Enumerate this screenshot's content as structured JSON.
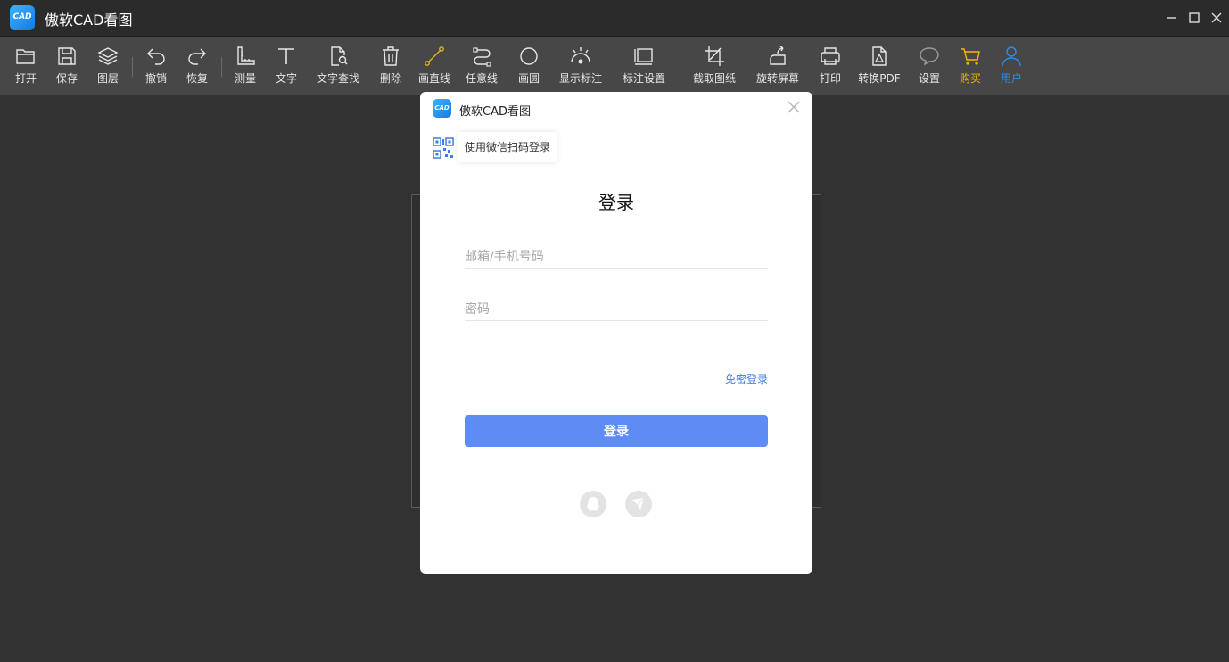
{
  "window": {
    "title": "傲软CAD看图",
    "logo_text": "CAD"
  },
  "toolbar": {
    "items": [
      {
        "label": "打开",
        "icon": "folder-icon"
      },
      {
        "label": "保存",
        "icon": "save-icon"
      },
      {
        "label": "图层",
        "icon": "layers-icon"
      },
      {
        "label": "撤销",
        "icon": "undo-icon"
      },
      {
        "label": "恢复",
        "icon": "redo-icon"
      },
      {
        "label": "测量",
        "icon": "ruler-icon"
      },
      {
        "label": "文字",
        "icon": "text-icon"
      },
      {
        "label": "文字查找",
        "icon": "text-search-icon"
      },
      {
        "label": "删除",
        "icon": "trash-icon"
      },
      {
        "label": "画直线",
        "icon": "line-icon"
      },
      {
        "label": "任意线",
        "icon": "polyline-icon"
      },
      {
        "label": "画圆",
        "icon": "circle-icon"
      },
      {
        "label": "显示标注",
        "icon": "show-annotation-icon"
      },
      {
        "label": "标注设置",
        "icon": "annotation-settings-icon"
      },
      {
        "label": "截取图纸",
        "icon": "crop-icon"
      },
      {
        "label": "旋转屏幕",
        "icon": "rotate-icon"
      },
      {
        "label": "打印",
        "icon": "printer-icon"
      },
      {
        "label": "转换PDF",
        "icon": "pdf-icon"
      },
      {
        "label": "设置",
        "icon": "chat-bubble-icon"
      },
      {
        "label": "购买",
        "icon": "cart-icon"
      },
      {
        "label": "用户",
        "icon": "user-icon"
      }
    ],
    "colors": {
      "buy": "#f5b800",
      "user": "#2f8bf0",
      "active_line": "#e6b422"
    }
  },
  "login_dialog": {
    "title": "傲软CAD看图",
    "logo_text": "CAD",
    "qr_tip": "使用微信扫码登录",
    "heading": "登录",
    "email_placeholder": "邮箱/手机号码",
    "email_value": "",
    "password_placeholder": "密码",
    "password_value": "",
    "free_login_link": "免密登录",
    "submit_label": "登录",
    "social": [
      "qq-icon",
      "weibo-icon"
    ],
    "accent_color": "#5e8cf5"
  }
}
